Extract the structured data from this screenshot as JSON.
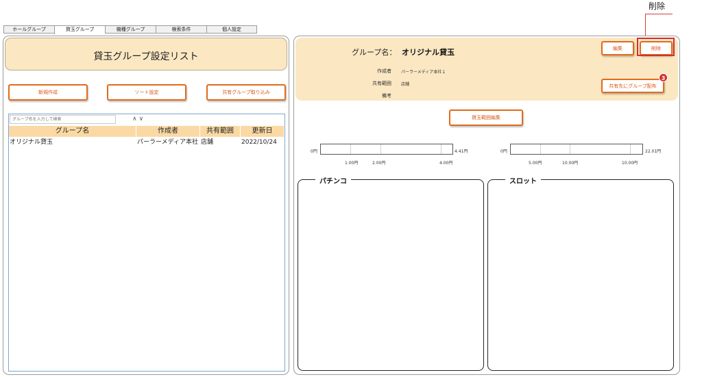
{
  "callout": {
    "label": "削除"
  },
  "tabs": [
    {
      "label": "ホールグループ"
    },
    {
      "label": "貸玉グループ"
    },
    {
      "label": "機種グループ"
    },
    {
      "label": "検索条件"
    },
    {
      "label": "個人設定"
    }
  ],
  "left": {
    "title": "貸玉グループ設定リスト",
    "buttons": {
      "new": "新規作成",
      "sort": "ソート設定",
      "import": "共有グループ取り込み"
    },
    "search_placeholder": "グループ名を入力して検索",
    "sort_arrows": "∧∨",
    "columns": [
      "グループ名",
      "作成者",
      "共有範囲",
      "更新日"
    ],
    "rows": [
      [
        "オリジナル貸玉",
        "パーラーメディア本社１",
        "店舗",
        "2022/10/24"
      ]
    ]
  },
  "right": {
    "group_label": "グループ名：",
    "group_name": "オリジナル貸玉",
    "edit_label": "編集",
    "delete_label": "削除",
    "share_label": "共有先にグループ配布",
    "share_badge": "3",
    "meta": {
      "creator_label": "作成者",
      "creator": "パーラーメディア本社１",
      "scope_label": "共有範囲",
      "scope": "店舗",
      "note_label": "備考",
      "note": ""
    },
    "range_edit_label": "貸玉範囲編集",
    "pachinko_range": {
      "min": "0円",
      "max": "4.41円",
      "ticks": [
        "1.00円",
        "2.00円",
        "4.00円"
      ]
    },
    "slot_range": {
      "min": "0円",
      "max": "22.01円",
      "ticks": [
        "5.00円",
        "10.00円",
        "10.00円"
      ]
    },
    "pachinko_title": "パチンコ",
    "slot_title": "スロット"
  },
  "colors": {
    "accent": "#e06b1a",
    "header_bg": "#fbe7c2",
    "table_header": "#fbd9a4",
    "highlight": "#d03030"
  }
}
